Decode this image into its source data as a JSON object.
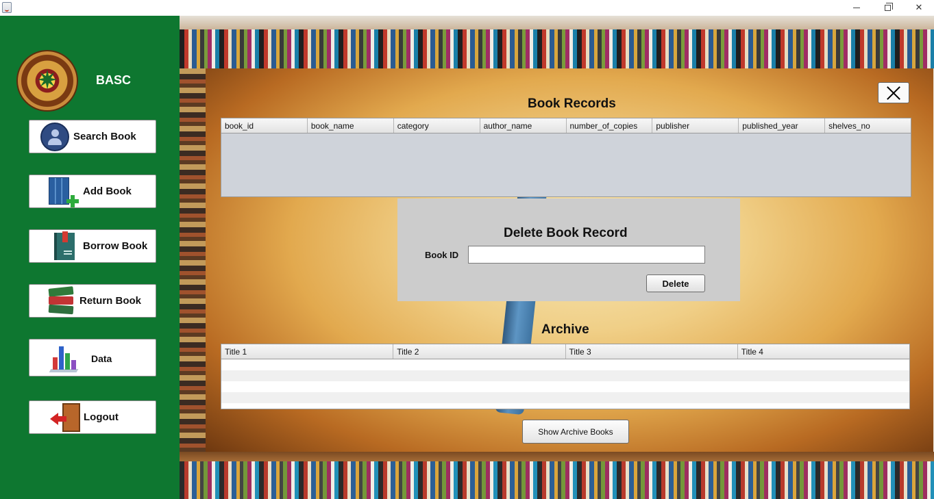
{
  "window": {
    "icon": "java-cup-icon",
    "controls": [
      "minimize-icon",
      "maximize-icon",
      "close-icon"
    ]
  },
  "sidebar": {
    "brand": "BASC",
    "logo_text": "BULACAN AGRICULTURAL STATE COLLEGE 1952",
    "background_color": "#0e7730",
    "buttons": [
      {
        "label": "Search Book",
        "icon": "user-search-icon"
      },
      {
        "label": "Add Book",
        "icon": "add-book-icon"
      },
      {
        "label": "Borrow Book",
        "icon": "book-icon"
      },
      {
        "label": "Return Book",
        "icon": "book-stack-icon"
      },
      {
        "label": "Data",
        "icon": "bar-chart-icon"
      },
      {
        "label": "Logout",
        "icon": "logout-door-icon"
      }
    ]
  },
  "book_records": {
    "title": "Book Records",
    "columns": [
      "book_id",
      "book_name",
      "category",
      "author_name",
      "number_of_copies",
      "publisher",
      "published_year",
      "shelves_no"
    ],
    "rows": []
  },
  "delete_form": {
    "title": "Delete Book Record",
    "book_id_label": "Book ID",
    "book_id_value": "",
    "delete_label": "Delete"
  },
  "archive": {
    "title": "Archive",
    "columns": [
      "Title 1",
      "Title 2",
      "Title 3",
      "Title 4"
    ],
    "rows": [
      [
        "",
        "",
        "",
        ""
      ],
      [
        "",
        "",
        "",
        ""
      ],
      [
        "",
        "",
        "",
        ""
      ],
      [
        "",
        "",
        "",
        ""
      ]
    ],
    "show_button_label": "Show Archive Books"
  }
}
